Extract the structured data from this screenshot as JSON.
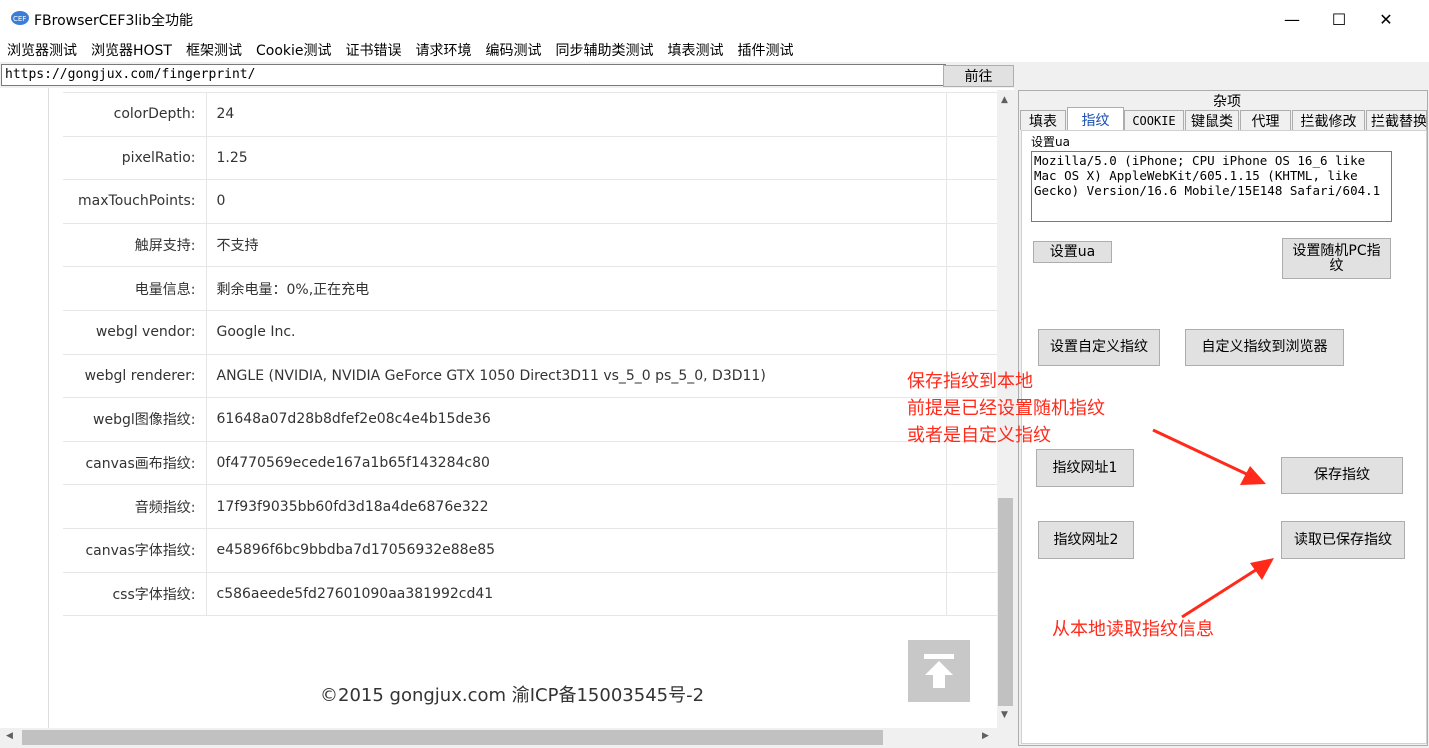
{
  "window": {
    "title": "FBrowserCEF3lib全功能",
    "icon_label": "CEF",
    "controls": {
      "minimize": "—",
      "maximize": "☐",
      "close": "✕"
    }
  },
  "menu": [
    "浏览器测试",
    "浏览器HOST",
    "框架测试",
    "Cookie测试",
    "证书错误",
    "请求环境",
    "编码测试",
    "同步辅助类测试",
    "填表测试",
    "插件测试"
  ],
  "address_bar": {
    "url": "https://gongjux.com/fingerprint/",
    "go_label": "前往"
  },
  "fingerprint_table": [
    {
      "label": "colorDepth:",
      "value": "24"
    },
    {
      "label": "pixelRatio:",
      "value": "1.25"
    },
    {
      "label": "maxTouchPoints:",
      "value": "0"
    },
    {
      "label": "触屏支持:",
      "value": "不支持"
    },
    {
      "label": "电量信息:",
      "value": "剩余电量：0%,正在充电"
    },
    {
      "label": "webgl vendor:",
      "value": "Google Inc."
    },
    {
      "label": "webgl renderer:",
      "value": "ANGLE (NVIDIA, NVIDIA GeForce GTX 1050 Direct3D11 vs_5_0 ps_5_0, D3D11)"
    },
    {
      "label": "webgl图像指纹:",
      "value": "61648a07d28b8dfef2e08c4e4b15de36"
    },
    {
      "label": "canvas画布指纹:",
      "value": "0f4770569ecede167a1b65f143284c80"
    },
    {
      "label": "音频指纹:",
      "value": "17f93f9035bb60fd3d18a4de6876e322"
    },
    {
      "label": "canvas字体指纹:",
      "value": "e45896f6bc9bbdba7d17056932e88e85"
    },
    {
      "label": "css字体指纹:",
      "value": "c586aeede5fd27601090aa381992cd41"
    }
  ],
  "footer": "©2015 gongjux.com 渝ICP备15003545号-2",
  "panel": {
    "title": "杂项",
    "tabs": [
      "填表",
      "指纹",
      "COOKIE",
      "键鼠类",
      "代理",
      "拦截修改",
      "拦截替换"
    ],
    "active_tab": "指纹",
    "ua_label": "设置ua",
    "ua_value": "Mozilla/5.0 (iPhone; CPU iPhone OS 16_6 like Mac OS X) AppleWebKit/605.1.15 (KHTML, like Gecko) Version/16.6 Mobile/15E148 Safari/604.1",
    "buttons": {
      "set_ua": "设置ua",
      "set_random_pc": "设置随机PC指纹",
      "set_custom": "设置自定义指纹",
      "custom_to_browser": "自定义指纹到浏览器",
      "fp_url1": "指纹网址1",
      "save_fp": "保存指纹",
      "fp_url2": "指纹网址2",
      "read_saved": "读取已保存指纹"
    }
  },
  "annotations": {
    "save_note": [
      "保存指纹到本地",
      "前提是已经设置随机指纹",
      "或者是自定义指纹"
    ],
    "read_note": "从本地读取指纹信息",
    "color": "#ff2a1a"
  }
}
